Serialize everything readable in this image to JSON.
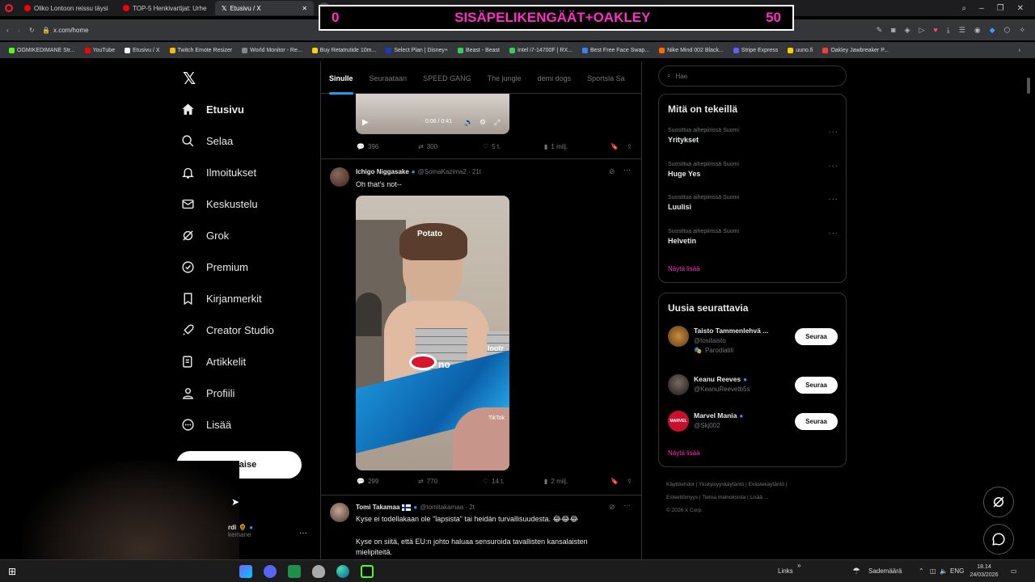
{
  "browser": {
    "tabs": [
      {
        "label": "Oliko Lontoon reissu täysi",
        "color": "#ff0000"
      },
      {
        "label": "TOP-5 Henkivartijat: Urhe",
        "color": "#ff0000"
      },
      {
        "label": "Etusivu / X",
        "color": "#ffffff"
      }
    ],
    "url": "x.com/home",
    "bookmarks": [
      {
        "label": "OGMIKEDIMANE Str...",
        "color": "#53fc18"
      },
      {
        "label": "YouTube",
        "color": "#ff0000"
      },
      {
        "label": "Etusivu / X",
        "color": "#ffffff"
      },
      {
        "label": "Twitch Emote Resizer",
        "color": "#fbbc04"
      },
      {
        "label": "World Monitor - Re...",
        "color": "#888888"
      },
      {
        "label": "Buy Retatrutide 10m...",
        "color": "#ffd000"
      },
      {
        "label": "Select Plan | Disney+",
        "color": "#113ccf"
      },
      {
        "label": "Beast - Beast",
        "color": "#34d058"
      },
      {
        "label": "Intel i7-14700F | RX...",
        "color": "#34d058"
      },
      {
        "label": "Best Free Face Swap...",
        "color": "#3b82f6"
      },
      {
        "label": "Nike Mind 002 Black...",
        "color": "#ff6a00"
      },
      {
        "label": "Stripe Express",
        "color": "#635bff"
      },
      {
        "label": "uuno.fi",
        "color": "#ffcc00"
      },
      {
        "label": "Oakley Jawbreaker P...",
        "color": "#ff3b30"
      }
    ]
  },
  "overlay": {
    "left": "0",
    "title": "SISÄPELIKENGÄÄT+OAKLEY",
    "right": "50"
  },
  "nav": {
    "items": [
      {
        "label": "Etusivu",
        "icon": "home-icon"
      },
      {
        "label": "Selaa",
        "icon": "search-icon"
      },
      {
        "label": "Ilmoitukset",
        "icon": "bell-icon"
      },
      {
        "label": "Keskustelu",
        "icon": "mail-icon"
      },
      {
        "label": "Grok",
        "icon": "grok-icon"
      },
      {
        "label": "Premium",
        "icon": "verified-icon"
      },
      {
        "label": "Kirjanmerkit",
        "icon": "bookmark-icon"
      },
      {
        "label": "Creator Studio",
        "icon": "rocket-icon"
      },
      {
        "label": "Artikkelit",
        "icon": "article-icon"
      },
      {
        "label": "Profiili",
        "icon": "person-icon"
      },
      {
        "label": "Lisää",
        "icon": "more-icon"
      }
    ],
    "post_button": "Julkaise",
    "account_name": "rdi",
    "account_handle": "kemane"
  },
  "feed": {
    "tabs": [
      "Sinulle",
      "Seuraataan",
      "SPEED GANG",
      "The jungle",
      "demi dogs",
      "Sportsla Sa"
    ],
    "video_time": "0:06 / 0:41",
    "post1_stats": {
      "replies": "396",
      "reposts": "300",
      "likes": "5 t.",
      "views": "1 milj."
    },
    "post2": {
      "name": "Ichigo Niggasake",
      "handle": "@SomaKazima2 · 21t",
      "text": "Oh that's not--",
      "caption1": "Potato",
      "caption2": "no",
      "caption3": "lootr",
      "watermark": "TikTok",
      "stats": {
        "replies": "299",
        "reposts": "770",
        "likes": "14 t.",
        "views": "2 milj."
      }
    },
    "post3": {
      "name": "Tomi Takamaa",
      "handle": "@tomitakamaa · 2t",
      "line1": "Kyse ei todellakaan ole \"lapsista\" tai heidän turvallisuudesta. 😂😂😂",
      "line2": "Kyse on siitä, että EU:n johto haluaa sensuroida tavallisten kansalaisten mielipiteitä."
    }
  },
  "right": {
    "search_placeholder": "Hae",
    "trends_title": "Mitä on tekeillä",
    "trends": [
      {
        "sub": "Suosittua aihepiirissä Suomi",
        "name": "Yritykset"
      },
      {
        "sub": "Suosittua aihepiirissä Suomi",
        "name": "Huge Yes"
      },
      {
        "sub": "Suosittua aihepiirissä Suomi",
        "name": "Luulisi"
      },
      {
        "sub": "Suosittua aihepiirissä Suomi",
        "name": "Helvetin"
      }
    ],
    "show_more": "Näytä lisää",
    "follow_title": "Uusia seurattavia",
    "follow": [
      {
        "name": "Taisto Tammenlehvä ...",
        "handle": "@tositaisto",
        "tag": "Parodiatili",
        "button": "Seuraa"
      },
      {
        "name": "Keanu Reeves",
        "handle": "@KeanuReevetb5s",
        "tag": "",
        "button": "Seuraa"
      },
      {
        "name": "Marvel Mania",
        "handle": "@Skj002",
        "tag": "",
        "button": "Seuraa"
      }
    ],
    "footer": [
      "Käyttöehdot",
      "Yksityisyyskäytäntö",
      "Evästekäytäntö",
      "Esteettömyys",
      "Tietoa mainoksista",
      "Lisää ...",
      "© 2026 X Corp."
    ]
  },
  "taskbar": {
    "links": "Links",
    "weather": "Sademäärä",
    "lang": "ENG",
    "time": "18.14",
    "date": "24/03/2026"
  }
}
